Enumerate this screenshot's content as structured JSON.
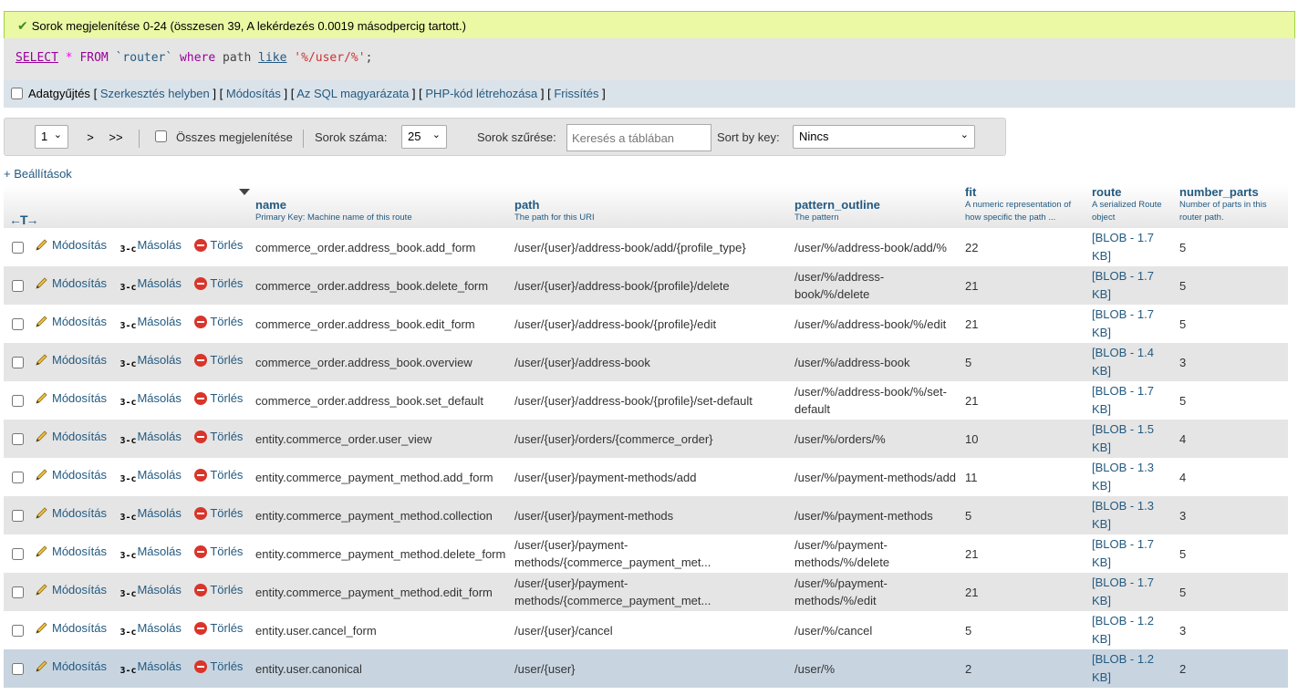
{
  "notice": {
    "text": "Sorok megjelenítése 0-24 (összesen 39, A lekérdezés 0.0019 másodpercig tartott.)"
  },
  "sql": {
    "select": "SELECT",
    "star": "*",
    "from": "FROM",
    "table": "`router`",
    "where": "where",
    "column": "path",
    "like": "like",
    "pattern": "'%/user/%'",
    "semicolon": ";"
  },
  "sql_actions": {
    "profiling_label": "Adatgyűjtés",
    "open_bracket": "[",
    "sep": "] [",
    "close_bracket": "]",
    "edit_inline": "Szerkesztés helyben",
    "edit": "Módosítás",
    "explain": "Az SQL magyarázata",
    "php_code": "PHP-kód létrehozása",
    "refresh": "Frissítés"
  },
  "navigation": {
    "page_value": "1",
    "next": ">",
    "last": ">>",
    "show_all_label": "Összes megjelenítése",
    "rows_label": "Sorok száma:",
    "rows_value": "25",
    "filter_label": "Sorok szűrése:",
    "filter_placeholder": "Keresés a táblában",
    "sort_label": "Sort by key:",
    "sort_value": "Nincs"
  },
  "settings_link": "+ Beállítások",
  "table": {
    "columns": [
      {
        "name": "name",
        "comment": "Primary Key: Machine name of this route"
      },
      {
        "name": "path",
        "comment": "The path for this URI"
      },
      {
        "name": "pattern_outline",
        "comment": "The pattern"
      },
      {
        "name": "fit",
        "comment": "A numeric representation of how specific the path ..."
      },
      {
        "name": "route",
        "comment": "A serialized Route object"
      },
      {
        "name": "number_parts",
        "comment": "Number of parts in this router path."
      }
    ],
    "actions": {
      "edit": "Módosítás",
      "copy": "Másolás",
      "delete": "Törlés"
    },
    "rows": [
      {
        "name": "commerce_order.address_book.add_form",
        "path": "/user/{user}/address-book/add/{profile_type}",
        "pattern": "/user/%/address-book/add/%",
        "fit": "22",
        "route": "[BLOB - 1.7 KB]",
        "parts": "5"
      },
      {
        "name": "commerce_order.address_book.delete_form",
        "path": "/user/{user}/address-book/{profile}/delete",
        "pattern": "/user/%/address-book/%/delete",
        "fit": "21",
        "route": "[BLOB - 1.7 KB]",
        "parts": "5"
      },
      {
        "name": "commerce_order.address_book.edit_form",
        "path": "/user/{user}/address-book/{profile}/edit",
        "pattern": "/user/%/address-book/%/edit",
        "fit": "21",
        "route": "[BLOB - 1.7 KB]",
        "parts": "5"
      },
      {
        "name": "commerce_order.address_book.overview",
        "path": "/user/{user}/address-book",
        "pattern": "/user/%/address-book",
        "fit": "5",
        "route": "[BLOB - 1.4 KB]",
        "parts": "3"
      },
      {
        "name": "commerce_order.address_book.set_default",
        "path": "/user/{user}/address-book/{profile}/set-default",
        "pattern": "/user/%/address-book/%/set-default",
        "fit": "21",
        "route": "[BLOB - 1.7 KB]",
        "parts": "5"
      },
      {
        "name": "entity.commerce_order.user_view",
        "path": "/user/{user}/orders/{commerce_order}",
        "pattern": "/user/%/orders/%",
        "fit": "10",
        "route": "[BLOB - 1.5 KB]",
        "parts": "4"
      },
      {
        "name": "entity.commerce_payment_method.add_form",
        "path": "/user/{user}/payment-methods/add",
        "pattern": "/user/%/payment-methods/add",
        "fit": "11",
        "route": "[BLOB - 1.3 KB]",
        "parts": "4"
      },
      {
        "name": "entity.commerce_payment_method.collection",
        "path": "/user/{user}/payment-methods",
        "pattern": "/user/%/payment-methods",
        "fit": "5",
        "route": "[BLOB - 1.3 KB]",
        "parts": "3"
      },
      {
        "name": "entity.commerce_payment_method.delete_form",
        "path": "/user/{user}/payment-methods/{commerce_payment_met...",
        "pattern": "/user/%/payment-methods/%/delete",
        "fit": "21",
        "route": "[BLOB - 1.7 KB]",
        "parts": "5"
      },
      {
        "name": "entity.commerce_payment_method.edit_form",
        "path": "/user/{user}/payment-methods/{commerce_payment_met...",
        "pattern": "/user/%/payment-methods/%/edit",
        "fit": "21",
        "route": "[BLOB - 1.7 KB]",
        "parts": "5"
      },
      {
        "name": "entity.user.cancel_form",
        "path": "/user/{user}/cancel",
        "pattern": "/user/%/cancel",
        "fit": "5",
        "route": "[BLOB - 1.2 KB]",
        "parts": "3"
      },
      {
        "name": "entity.user.canonical",
        "path": "/user/{user}",
        "pattern": "/user/%",
        "fit": "2",
        "route": "[BLOB - 1.2 KB]",
        "parts": "2"
      }
    ]
  }
}
